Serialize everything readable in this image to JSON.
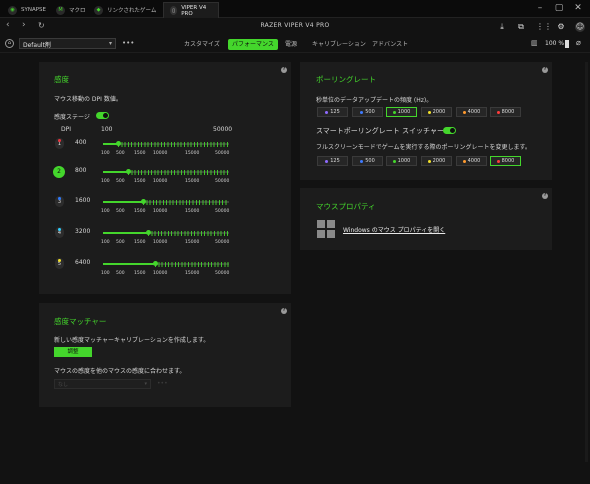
{
  "tabs": [
    {
      "label": "SYNAPSE",
      "icon": "razer-icon"
    },
    {
      "label": "マクロ",
      "icon": "macro-icon"
    },
    {
      "label": "リンクされたゲーム",
      "icon": "gamepad-icon"
    },
    {
      "label": "VIPER V4 PRO",
      "icon": "mouse-icon"
    }
  ],
  "app_title": "RAZER VIPER V4 PRO",
  "profile": {
    "value": "Default剤"
  },
  "subtabs": [
    "カスタマイズ",
    "パフォーマンス",
    "電源",
    "キャリブレーション",
    "アドバンスト"
  ],
  "battery": {
    "label": "100 %"
  },
  "sensitivity": {
    "title": "感度",
    "desc": "マウス移動の DPI 数値。",
    "stages_label": "感度ステージ",
    "dpi_label": "DPI",
    "min_label": "100",
    "max_label": "50000",
    "scale": [
      "100",
      "500",
      "1500",
      "10000",
      "15000",
      "50000"
    ],
    "stages": [
      {
        "num": "1",
        "dpi": "400",
        "color": "#e8323c",
        "fraction": 0.12
      },
      {
        "num": "2",
        "dpi": "800",
        "color": "#44d62c",
        "fraction": 0.2
      },
      {
        "num": "3",
        "dpi": "1600",
        "color": "#2f7bff",
        "fraction": 0.32
      },
      {
        "num": "4",
        "dpi": "3200",
        "color": "#2fd0ff",
        "fraction": 0.36
      },
      {
        "num": "5",
        "dpi": "6400",
        "color": "#f2e12b",
        "fraction": 0.41
      }
    ]
  },
  "polling": {
    "title": "ポーリングレート",
    "desc": "秒単位のデータアップデートの頻度 (Hz)。",
    "rates": [
      {
        "label": "125",
        "color": "#8f6bff"
      },
      {
        "label": "500",
        "color": "#3f7bff"
      },
      {
        "label": "1000",
        "color": "#44d62c"
      },
      {
        "label": "2000",
        "color": "#f2e12b"
      },
      {
        "label": "4000",
        "color": "#ff9a2f"
      },
      {
        "label": "8000",
        "color": "#ff3b3b"
      }
    ],
    "selected_top": "1000",
    "smart_label": "スマートポーリングレート スイッチャー",
    "fullscreen_desc": "フルスクリーンモードでゲームを実行する際のポーリングレートを変更します。",
    "selected_bottom": "8000"
  },
  "mouse_props": {
    "title": "マウスプロパティ",
    "link": "Windows のマウス プロパティを開く"
  },
  "matcher": {
    "title": "感度マッチャー",
    "desc": "新しい感度マッチャーキャリブレーションを作成します。",
    "button": "調整",
    "match_label": "マウスの感度を他のマウスの感度に合わせます。",
    "select_value": "なし"
  }
}
